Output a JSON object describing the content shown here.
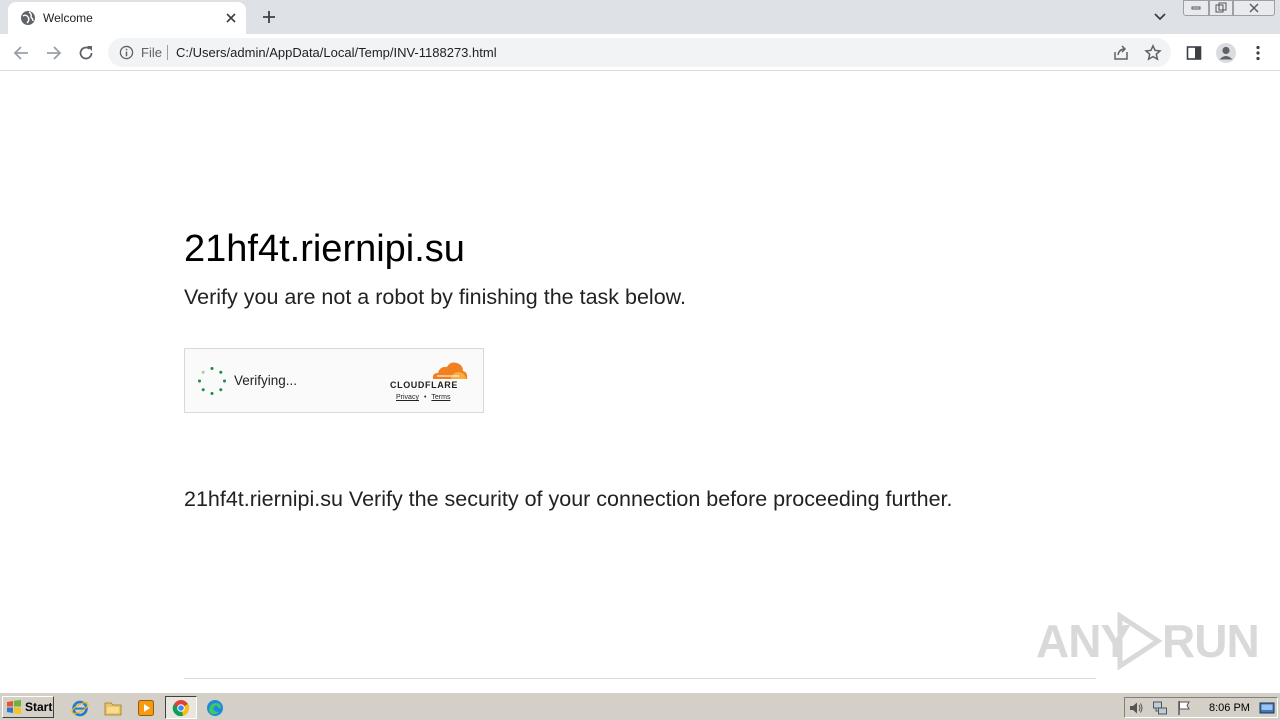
{
  "browser": {
    "tab": {
      "title": "Welcome"
    },
    "address_bar": {
      "scheme_label": "File",
      "url": "C:/Users/admin/AppData/Local/Temp/INV-1188273.html"
    }
  },
  "page": {
    "site_title": "21hf4t.riernipi.su",
    "subtitle": "Verify you are not a robot by finishing the task below.",
    "captcha": {
      "status_text": "Verifying...",
      "brand": "CLOUDFLARE",
      "privacy_link": "Privacy",
      "separator": "•",
      "terms_link": "Terms",
      "brand_color": "#f38020"
    },
    "message": "21hf4t.riernipi.su Verify the security of your connection before proceeding further."
  },
  "watermark": {
    "left": "ANY",
    "right": "RUN"
  },
  "taskbar": {
    "start_label": "Start",
    "clock": "8:06 PM"
  }
}
